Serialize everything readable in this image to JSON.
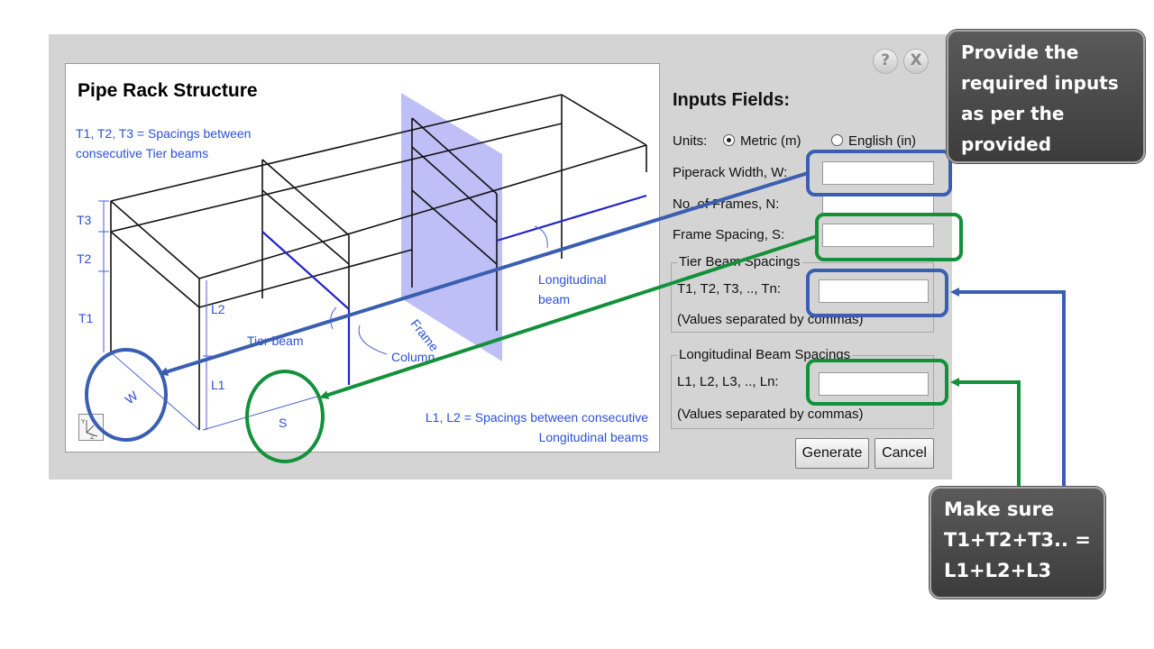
{
  "dialog": {
    "help_glyph": "?",
    "close_glyph": "X",
    "sketch": {
      "title": "Pipe Rack Structure",
      "note_tier": "T1, T2, T3 = Spacings between consecutive Tier beams",
      "note_long": "L1, L2 = Spacings between consecutive Longitudinal beams",
      "labels": {
        "t3": "T3",
        "t2": "T2",
        "t1": "T1",
        "l2": "L2",
        "l1": "L1",
        "tier_beam": "Tier beam",
        "column": "Column",
        "longitudinal_beam": "Longitudinal beam",
        "frame": "Frame",
        "w": "W",
        "s": "S"
      },
      "axis_icon": "axis-triad-icon"
    },
    "inputs_title": "Inputs Fields:",
    "units_label": "Units:",
    "metric_label": "Metric (m)",
    "english_label": "English (in)",
    "selected_unit": "metric",
    "width_label": "Piperack Width, W:",
    "frames_label": "No. of Frames, N:",
    "spacing_label": "Frame Spacing, S:",
    "tier_group": {
      "legend": "Tier Beam Spacings",
      "label": "T1, T2, T3, .., Tn:",
      "hint": "(Values separated by commas)"
    },
    "long_group": {
      "legend": "Longitudinal Beam Spacings",
      "label": "L1, L2, L3, .., Ln:",
      "hint": "(Values separated by commas)"
    },
    "fields": {
      "width": "",
      "frames": "",
      "spacing": "",
      "tier": "",
      "long": ""
    },
    "generate_label": "Generate",
    "cancel_label": "Cancel"
  },
  "callouts": {
    "top": "Provide the required inputs as per the provided sketch.",
    "bottom": "Make sure T1+T2+T3.. = L1+L2+L3"
  },
  "colors": {
    "blue_annotation": "#3a5fb0",
    "green_annotation": "#13913a",
    "sketch_text": "#2d4fd6",
    "frame_plane": "#a9a9f5"
  }
}
